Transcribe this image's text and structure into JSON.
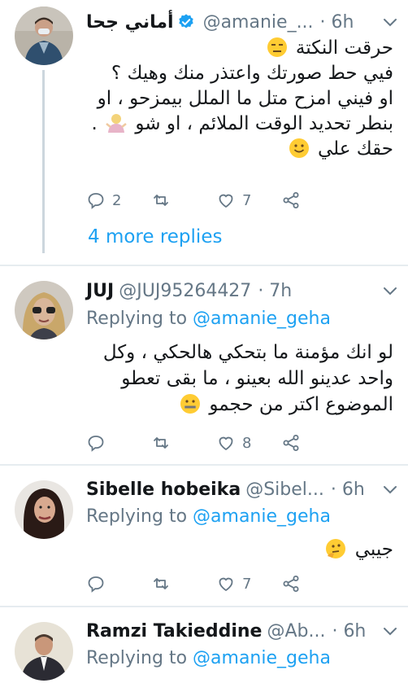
{
  "tweets": [
    {
      "name": "أماني جحا",
      "handle": "@amanie_...",
      "time": "· 6h",
      "body_lines": [
        "حرقت النكتة",
        "فيي حط صورتك واعتذر منك وهيك ؟",
        "او فيني امزح متل ما الملل بيمزحو ، او",
        "بنطر تحديد الوقت الملائم ، او شو",
        "حقك علي"
      ],
      "replies": "2",
      "likes": "7",
      "more_replies": "4 more replies"
    },
    {
      "name": "JUJ",
      "handle": "@JUJ95264427",
      "time": "· 7h",
      "replying_prefix": "Replying to",
      "replying_mention": "@amanie_geha",
      "body_lines": [
        "لو انك مؤمنة ما بتحكي هالحكي ، وكل",
        "واحد عدينو الله بعينو ، ما بقى تعطو",
        "الموضوع اكتر من حجمو"
      ],
      "likes": "8"
    },
    {
      "name": "Sibelle hobeika",
      "handle": "@Sibel...",
      "time": "· 6h",
      "replying_prefix": "Replying to",
      "replying_mention": "@amanie_geha",
      "body_lines": [
        "جيبي"
      ],
      "likes": "7"
    },
    {
      "name": "Ramzi Takieddine",
      "handle": "@Ab...",
      "time": "· 6h",
      "replying_prefix": "Replying to",
      "replying_mention": "@amanie_geha"
    }
  ],
  "colors": {
    "accent": "#1da1f2",
    "muted": "#657786",
    "divider": "#e6ecf0",
    "thread_line": "#ccd6dd"
  },
  "icons": [
    "reply-icon",
    "retweet-icon",
    "like-icon",
    "share-icon",
    "verified-badge-icon",
    "chevron-down-icon"
  ]
}
